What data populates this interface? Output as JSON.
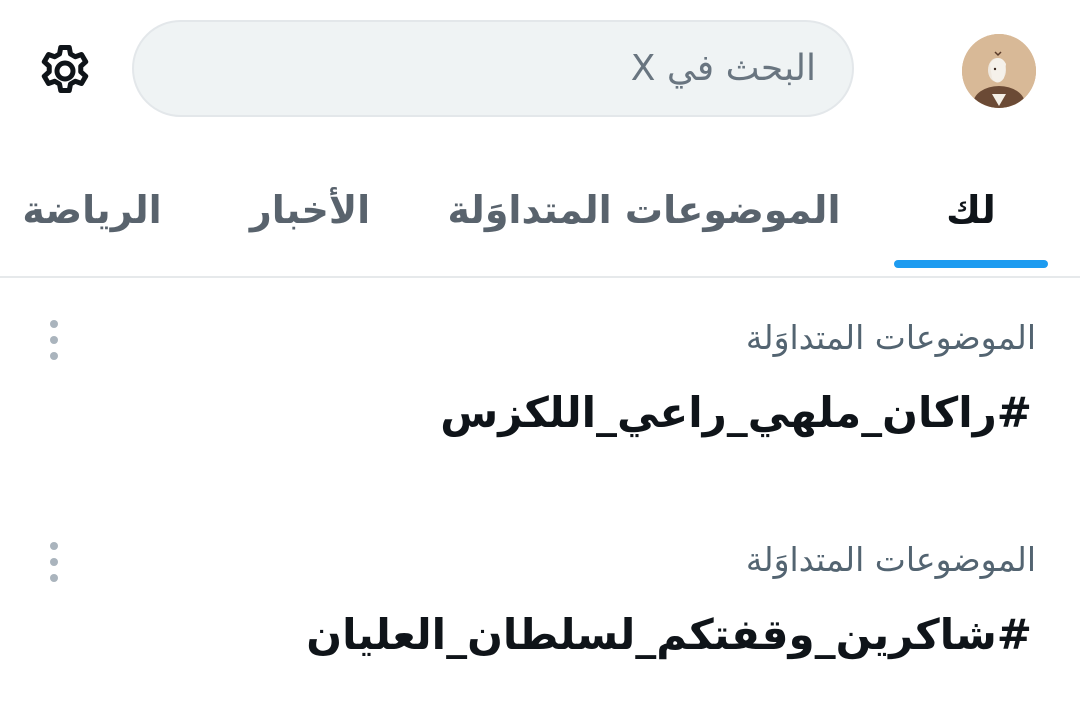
{
  "header": {
    "search_placeholder": "البحث في X",
    "settings_icon": "gear-icon",
    "avatar_icon": "profile-avatar"
  },
  "tabs": [
    {
      "label": "لك",
      "active": true
    },
    {
      "label": "الموضوعات المتداوَلة",
      "active": false
    },
    {
      "label": "الأخبار",
      "active": false
    },
    {
      "label": "الرياضة",
      "active": false
    }
  ],
  "trends": [
    {
      "context": "الموضوعات المتداوَلة",
      "name": "#راكان_ملهي_راعي_اللكزس"
    },
    {
      "context": "الموضوعات المتداوَلة",
      "name": "#شاكرين_وقفتكم_لسلطان_العليان"
    }
  ],
  "colors": {
    "accent": "#1d9bf0",
    "text_primary": "#0f1419",
    "text_secondary": "#536471",
    "search_bg": "#eff3f4"
  }
}
